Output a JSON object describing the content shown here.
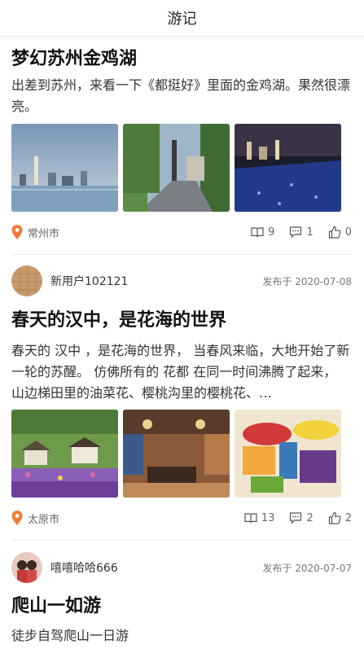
{
  "header": {
    "title": "游记"
  },
  "posts": [
    {
      "title": "梦幻苏州金鸡湖",
      "desc": "出差到苏州，来看一下《都挺好》里面的金鸡湖。果然很漂亮。",
      "location": "常州市",
      "reads": "9",
      "comments": "1",
      "likes": "0"
    },
    {
      "user": "新用户102121",
      "published": "发布于 2020-07-08",
      "title": "春天的汉中，是花海的世界",
      "desc": "春天的 汉中 ，是花海的世界， 当春风来临，大地开始了新一轮的苏醒。 仿佛所有的 花都 在同一时间沸腾了起来， 山边梯田里的油菜花、樱桃沟里的樱桃花、…",
      "location": "太原市",
      "reads": "13",
      "comments": "2",
      "likes": "2"
    },
    {
      "user": "嘻嘻哈哈666",
      "published": "发布于 2020-07-07",
      "title": "爬山一如游",
      "desc": "徒步自驾爬山一日游"
    }
  ],
  "colors": {
    "accent": "#f07c3a",
    "text": "#222222",
    "muted": "#777777"
  }
}
